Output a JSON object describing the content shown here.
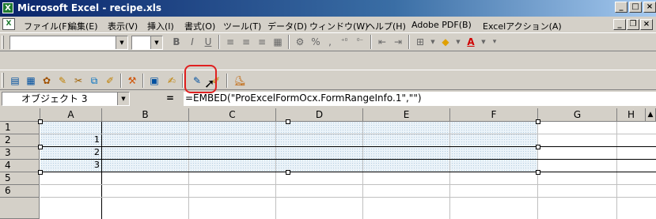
{
  "window": {
    "title": "Microsoft Excel - recipe.xls",
    "app_icon": "X"
  },
  "menubar": {
    "items": [
      "ファイル(F)",
      "編集(E)",
      "表示(V)",
      "挿入(I)",
      "書式(O)",
      "ツール(T)",
      "データ(D)",
      "ウィンドウ(W)",
      "ヘルプ(H)",
      "Adobe PDF(B)",
      "Excelアクション(A)"
    ]
  },
  "formatting": {
    "bold": "B",
    "italic": "I",
    "underline": "U",
    "percent": "%",
    "comma": ","
  },
  "formula_bar": {
    "name_box": "オブジェクト 3",
    "equals": "=",
    "formula": "=EMBED(\"ProExcelFormOcx.FormRangeInfo.1\",\"\")"
  },
  "sheet": {
    "columns": [
      "A",
      "B",
      "C",
      "D",
      "E",
      "F",
      "G",
      "H"
    ],
    "rows": [
      "1",
      "2",
      "3",
      "4",
      "5",
      "6"
    ],
    "cells": {
      "A2": "1",
      "A3": "2",
      "A4": "3"
    }
  },
  "colors": {
    "title_gradient_start": "#0a246a",
    "highlight_ring": "#e02020",
    "selection_fill": "#e8f1f8"
  }
}
